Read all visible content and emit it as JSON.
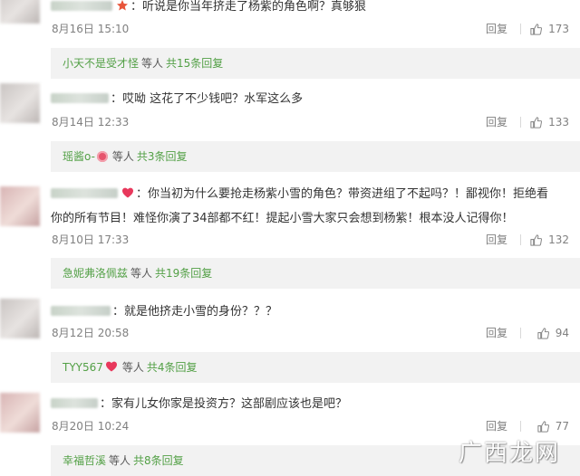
{
  "comments": [
    {
      "text": "听说是你当年挤走了杨紫的角色啊？真够狠",
      "date": "8月16日 15:10",
      "reply_label": "回复",
      "likes": "173",
      "thread": {
        "name": "小天不是受才怪",
        "mid": "等人",
        "count": "共15条回复"
      }
    },
    {
      "text": "哎呦 这花了不少钱吧？水军这么多",
      "date": "8月14日 12:33",
      "reply_label": "回复",
      "likes": "133",
      "thread": {
        "name": "瑶酱o-",
        "mid": "等人",
        "count": "共3条回复"
      }
    },
    {
      "text_line1": "你当初为什么要抢走杨紫小雪的角色？带资进组了不起吗？！鄙视你！拒绝看",
      "text_line2": "你的所有节目！难怪你演了34部都不红！提起小雪大家只会想到杨紫！根本没人记得你！",
      "date": "8月10日 17:33",
      "reply_label": "回复",
      "likes": "132",
      "thread": {
        "name": "急妮弗洛佩兹",
        "mid": "等人",
        "count": "共19条回复"
      }
    },
    {
      "text": "就是他挤走小雪的身份？？？",
      "date": "8月12日 20:58",
      "reply_label": "回复",
      "likes": "94",
      "thread": {
        "name": "TYY567",
        "mid": "等人",
        "count": "共4条回复"
      }
    },
    {
      "text": "家有儿女你家是投资方？这部剧应该也是吧？",
      "date": "8月20日 10:24",
      "reply_label": "回复",
      "likes": "77",
      "thread": {
        "name": "幸福哲溪",
        "mid": "等人",
        "count": "共8条回复"
      }
    }
  ],
  "watermark": "广西龙网",
  "icons": {
    "like": "thumbs-up-icon",
    "heart": "heart-icon",
    "emoji": "emoji-face-icon"
  },
  "colors": {
    "link": "#53a046",
    "meta": "#808080",
    "reply_bg": "#f2f2f2",
    "heart": "#e8385c"
  }
}
